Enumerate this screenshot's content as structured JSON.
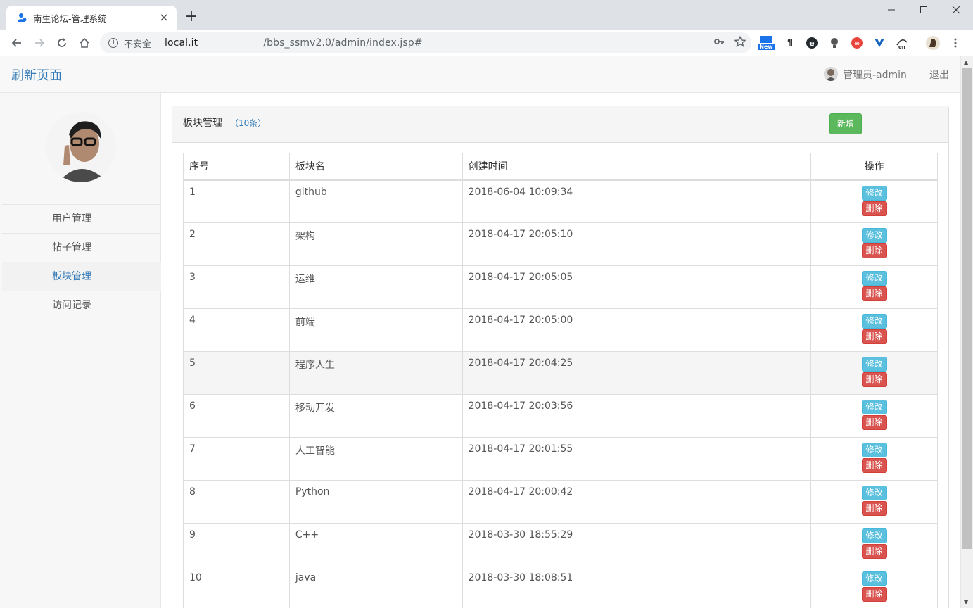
{
  "browser": {
    "tab_title": "南生论坛-管理系统",
    "tab_close": "×",
    "new_tab": "+",
    "security_label": "不安全",
    "url_host": "local.it",
    "url_path": "/bbs_ssmv2.0/admin/index.jsp#",
    "extension_badge": "New"
  },
  "header": {
    "brand": "刷新页面",
    "user_name": "管理员-admin",
    "logout": "退出"
  },
  "sidebar": {
    "items": [
      {
        "label": "用户管理",
        "active": false
      },
      {
        "label": "帖子管理",
        "active": false
      },
      {
        "label": "板块管理",
        "active": true
      },
      {
        "label": "访问记录",
        "active": false
      }
    ]
  },
  "panel": {
    "title": "板块管理",
    "count": "（10条）",
    "add_label": "新增"
  },
  "table": {
    "headers": [
      "序号",
      "板块名",
      "创建时间",
      "操作"
    ],
    "edit_label": "修改",
    "delete_label": "删除",
    "rows": [
      {
        "id": "1",
        "name": "github",
        "created": "2018-06-04 10:09:34"
      },
      {
        "id": "2",
        "name": "架构",
        "created": "2018-04-17 20:05:10"
      },
      {
        "id": "3",
        "name": "运维",
        "created": "2018-04-17 20:05:05"
      },
      {
        "id": "4",
        "name": "前端",
        "created": "2018-04-17 20:05:00"
      },
      {
        "id": "5",
        "name": "程序人生",
        "created": "2018-04-17 20:04:25"
      },
      {
        "id": "6",
        "name": "移动开发",
        "created": "2018-04-17 20:03:56"
      },
      {
        "id": "7",
        "name": "人工智能",
        "created": "2018-04-17 20:01:55"
      },
      {
        "id": "8",
        "name": "Python",
        "created": "2018-04-17 20:00:42"
      },
      {
        "id": "9",
        "name": "C++",
        "created": "2018-03-30 18:55:29"
      },
      {
        "id": "10",
        "name": "java",
        "created": "2018-03-30 18:08:51"
      }
    ]
  },
  "colors": {
    "brand": "#337ab7",
    "add_button": "#5cb85c",
    "edit_button": "#5bc0de",
    "delete_button": "#d9534f"
  }
}
